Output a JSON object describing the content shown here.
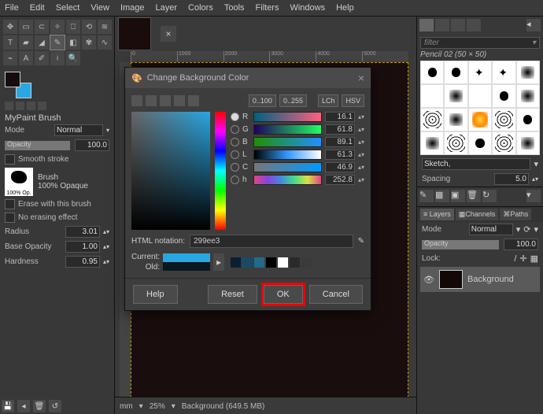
{
  "menu": {
    "items": [
      "File",
      "Edit",
      "Select",
      "View",
      "Image",
      "Layer",
      "Colors",
      "Tools",
      "Filters",
      "Windows",
      "Help"
    ]
  },
  "left": {
    "title": "MyPaint Brush",
    "mode_lbl": "Mode",
    "mode_val": "Normal",
    "opacity_lbl": "Opacity",
    "opacity_val": "100.0",
    "smooth": "Smooth stroke",
    "brush_lbl": "Brush",
    "brush_prev": "100% Op.",
    "brush_name": "100% Opaque",
    "erase": "Erase with this brush",
    "noerase": "No erasing effect",
    "radius_lbl": "Radius",
    "radius_val": "3.01",
    "baseop_lbl": "Base Opacity",
    "baseop_val": "1.00",
    "hard_lbl": "Hardness",
    "hard_val": "0.95"
  },
  "right": {
    "filter": "filter",
    "brushname": "Pencil 02 (50 × 50)",
    "preset_set": "Sketch,",
    "spacing_lbl": "Spacing",
    "spacing_val": "5.0",
    "tabs": {
      "layers": "Layers",
      "channels": "Channels",
      "paths": "Paths"
    },
    "mode_lbl": "Mode",
    "mode_val": "Normal",
    "opacity_lbl": "Opacity",
    "opacity_val": "100.0",
    "lock_lbl": "Lock:",
    "layer_name": "Background"
  },
  "status": {
    "unit": "mm",
    "zoom": "25%",
    "bg": "Background (649.5 MB)"
  },
  "ruler": [
    "0",
    "1000",
    "2000",
    "3000",
    "4000",
    "5000"
  ],
  "dialog": {
    "title": "Change Background Color",
    "range1": "0..100",
    "range2": "0..255",
    "lch": "LCh",
    "hsv": "HSV",
    "ch": [
      {
        "l": "R",
        "v": "16.1",
        "grad": "linear-gradient(to right,#006080,#ff6080)"
      },
      {
        "l": "G",
        "v": "61.8",
        "grad": "linear-gradient(to right,#200060,#20ff60)"
      },
      {
        "l": "B",
        "v": "89.1",
        "grad": "linear-gradient(to right,#209000,#2090ff)"
      },
      {
        "l": "L",
        "v": "61.3",
        "grad": "linear-gradient(to right,#000,#39f,#fff)"
      },
      {
        "l": "C",
        "v": "46.9",
        "grad": "linear-gradient(to right,#777,#09f)"
      },
      {
        "l": "h",
        "v": "252.8",
        "grad": "linear-gradient(to right,#d48,#84d,#48d,#4d8,#dd4,#d48)"
      }
    ],
    "html_lbl": "HTML notation:",
    "html_val": "299ee3",
    "current": "Current:",
    "old": "Old:",
    "swatches": [
      "#0a2030",
      "#1a4a6a",
      "#226a8a",
      "#000",
      "#fff",
      "#2a2a2a",
      "#3a3a3a"
    ],
    "help": "Help",
    "reset": "Reset",
    "ok": "OK",
    "cancel": "Cancel"
  }
}
